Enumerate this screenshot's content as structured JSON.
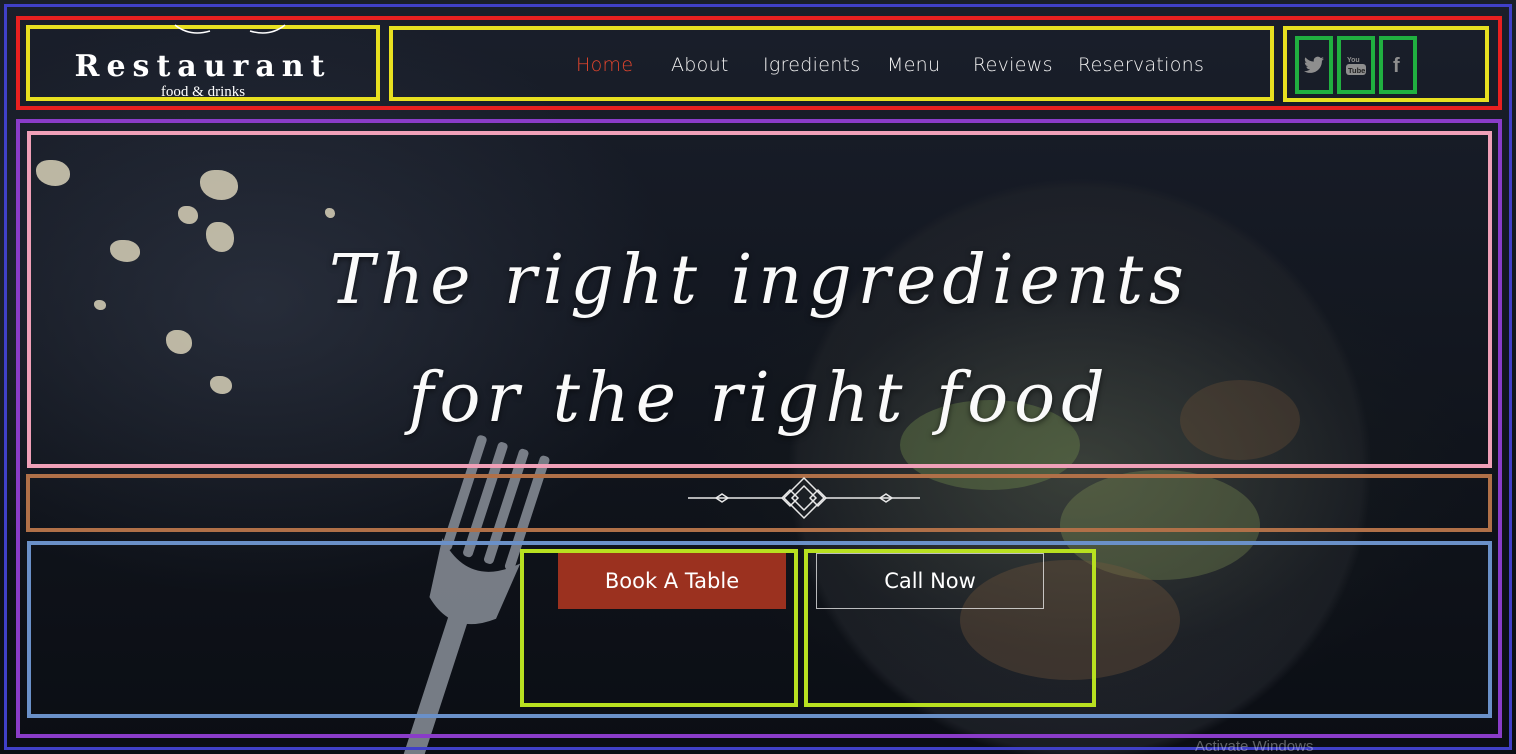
{
  "brand": {
    "title": "Restaurant",
    "subtitle": "food & drinks"
  },
  "nav": {
    "items": [
      "Home",
      "About",
      "Igredients",
      "Menu",
      "Reviews",
      "Reservations"
    ],
    "active": "Home",
    "active_color": "#e2452d"
  },
  "social": {
    "icons": [
      "twitter-icon",
      "youtube-icon",
      "facebook-icon"
    ],
    "youtube_label": "You Tube",
    "facebook_label": "f"
  },
  "hero": {
    "line1": "The right ingredients",
    "line2": "for the right food"
  },
  "actions": {
    "book_label": "Book A Table",
    "book_color": "#9b311f",
    "call_label": "Call Now"
  },
  "watermark": "Activate Windows"
}
